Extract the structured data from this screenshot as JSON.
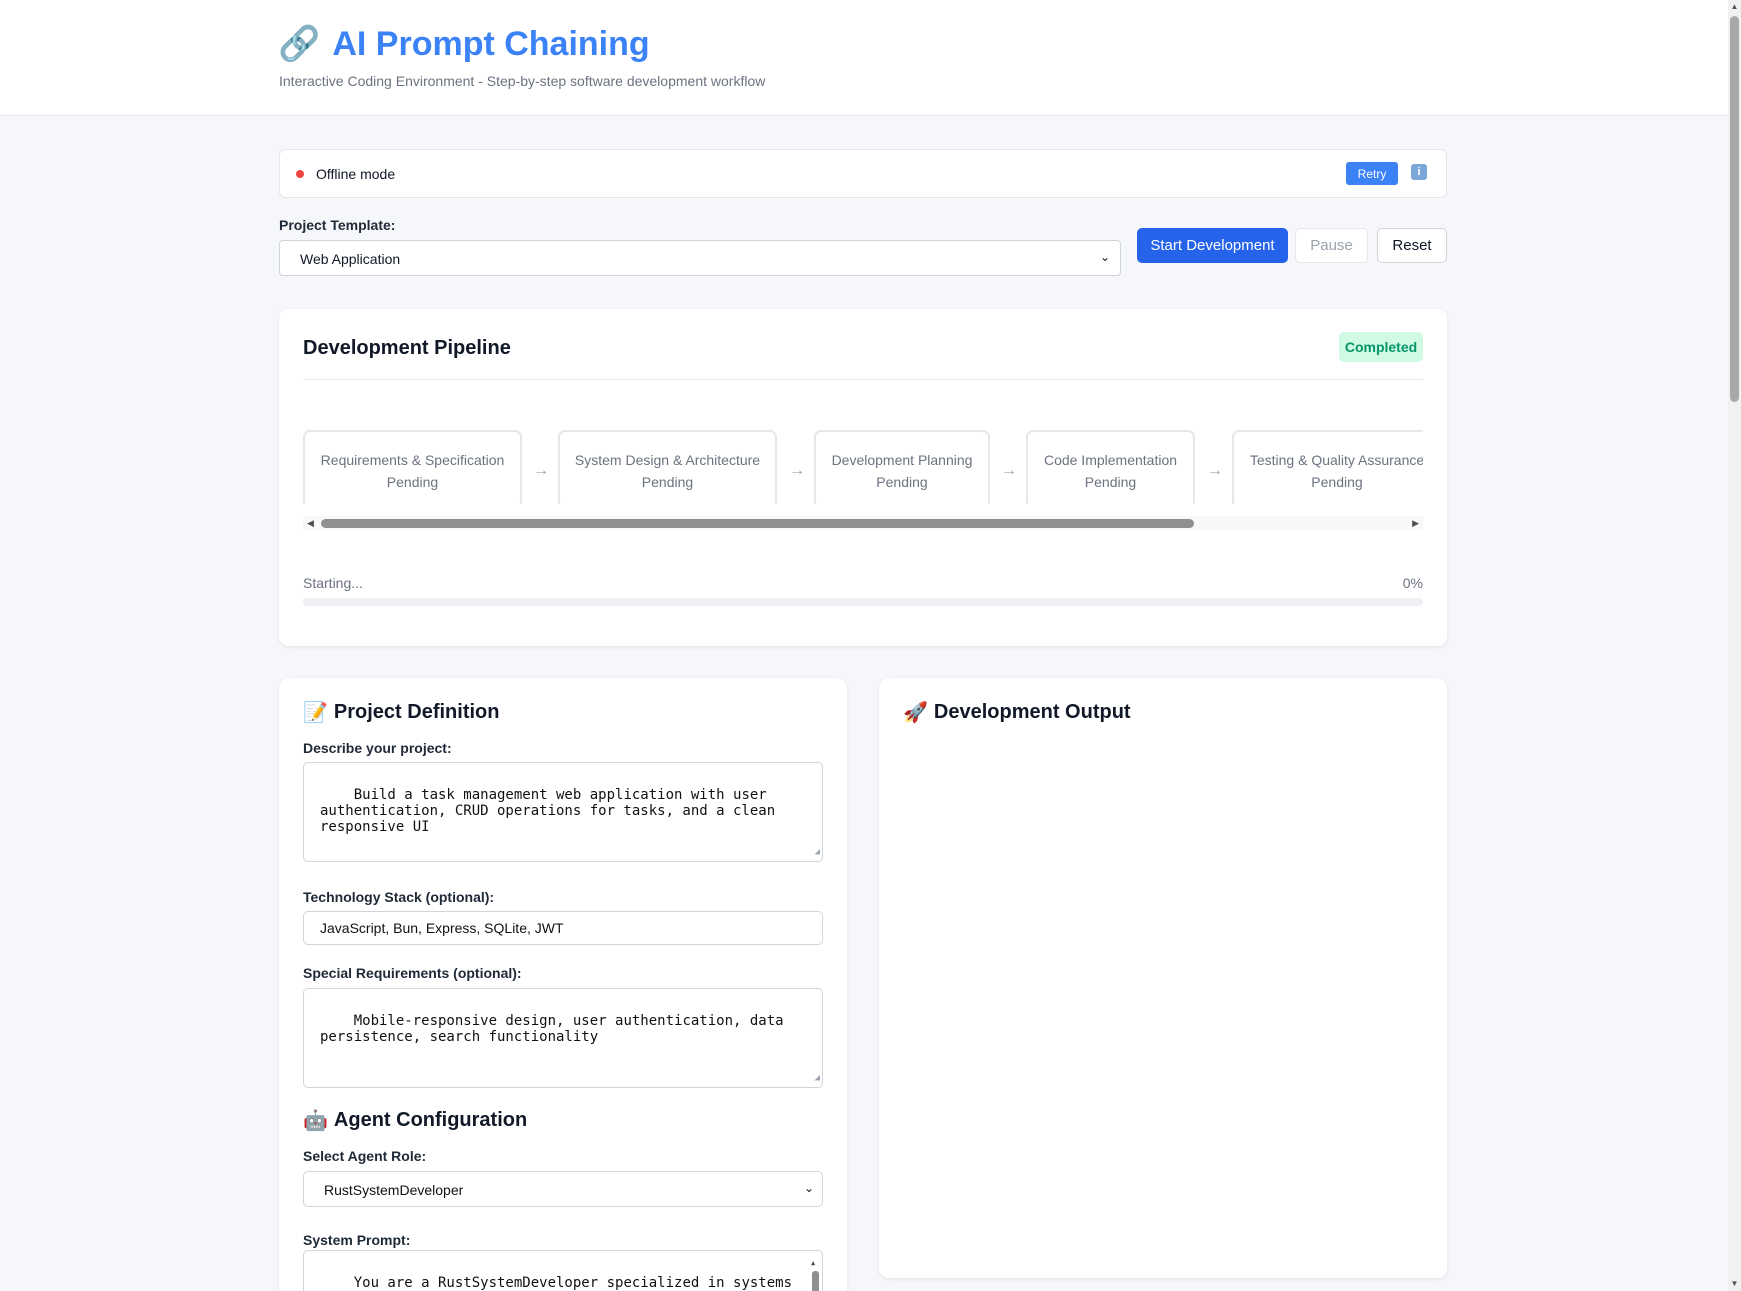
{
  "header": {
    "title": "AI Prompt Chaining",
    "subtitle": "Interactive Coding Environment - Step-by-step software development workflow",
    "title_icon": "link-icon"
  },
  "connection": {
    "status": "Offline mode",
    "status_color": "#ef4444",
    "retry_label": "Retry",
    "info_icon": "info-icon"
  },
  "template": {
    "label": "Project Template:",
    "selected": "Web Application"
  },
  "controls": {
    "start_label": "Start Development",
    "pause_label": "Pause",
    "reset_label": "Reset"
  },
  "pipeline": {
    "title": "Development Pipeline",
    "badge": "Completed",
    "steps": [
      {
        "name": "Requirements & Specification",
        "status": "Pending"
      },
      {
        "name": "System Design & Architecture",
        "status": "Pending"
      },
      {
        "name": "Development Planning",
        "status": "Pending"
      },
      {
        "name": "Code Implementation",
        "status": "Pending"
      },
      {
        "name": "Testing & Quality Assurance",
        "status": "Pending"
      }
    ],
    "arrow": "→",
    "progress_label": "Starting...",
    "progress_pct": "0%",
    "progress_value": 0
  },
  "project": {
    "title": "Project Definition",
    "title_icon": "memo-icon",
    "describe_label": "Describe your project:",
    "describe_value": "Build a task management web application with user authentication, CRUD operations for tasks, and a clean responsive UI",
    "stack_label": "Technology Stack (optional):",
    "stack_value": "JavaScript, Bun, Express, SQLite, JWT",
    "special_label": "Special Requirements (optional):",
    "special_value": "Mobile-responsive design, user authentication, data persistence, search functionality"
  },
  "agent": {
    "title": "Agent Configuration",
    "title_icon": "robot-icon",
    "role_label": "Select Agent Role:",
    "role_selected": "RustSystemDeveloper",
    "prompt_label": "System Prompt:",
    "prompt_value": "You are a RustSystemDeveloper specialized in systems programming with Rust. Focus on memory safety,"
  },
  "output": {
    "title": "Development Output",
    "title_icon": "rocket-icon"
  },
  "colors": {
    "accent": "#3b82f6",
    "primary_button": "#2563eb",
    "badge_bg": "#d1fae5",
    "badge_text": "#059669"
  }
}
